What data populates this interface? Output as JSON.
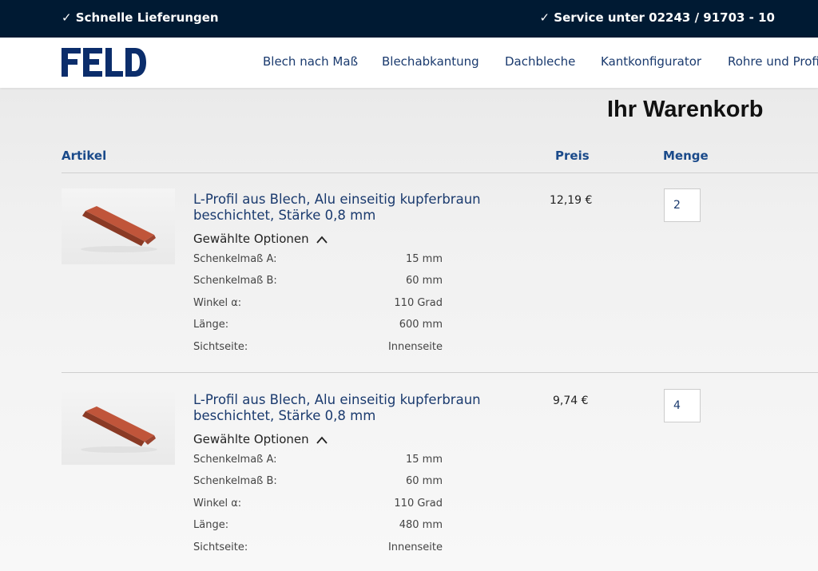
{
  "topbar": {
    "left": "✓ Schnelle Lieferungen",
    "right": "✓ Service unter 02243 / 91703 - 10"
  },
  "brand": {
    "logo_text": "FELD",
    "color": "#0b2d6b"
  },
  "nav": [
    "Blech nach Maß",
    "Blechabkantung",
    "Dachbleche",
    "Kantkonfigurator",
    "Rohre und Profi"
  ],
  "page": {
    "title": "Ihr Warenkorb"
  },
  "columns": {
    "article": "Artikel",
    "price": "Preis",
    "quantity": "Menge"
  },
  "cart": [
    {
      "title": "L-Profil aus Blech, Alu einseitig kupferbraun beschichtet, Stärke 0,8 mm",
      "options_label": "Gewählte Optionen",
      "options": [
        {
          "key": "Schenkelmaß A:",
          "value": "15 mm"
        },
        {
          "key": "Schenkelmaß B:",
          "value": "60 mm"
        },
        {
          "key": "Winkel α:",
          "value": "110 Grad"
        },
        {
          "key": "Länge:",
          "value": "600 mm"
        },
        {
          "key": "Sichtseite:",
          "value": "Innenseite"
        }
      ],
      "price": "12,19 €",
      "quantity": "2"
    },
    {
      "title": "L-Profil aus Blech, Alu einseitig kupferbraun beschichtet, Stärke 0,8 mm",
      "options_label": "Gewählte Optionen",
      "options": [
        {
          "key": "Schenkelmaß A:",
          "value": "15 mm"
        },
        {
          "key": "Schenkelmaß B:",
          "value": "60 mm"
        },
        {
          "key": "Winkel α:",
          "value": "110 Grad"
        },
        {
          "key": "Länge:",
          "value": "480 mm"
        },
        {
          "key": "Sichtseite:",
          "value": "Innenseite"
        }
      ],
      "price": "9,74 €",
      "quantity": "4"
    }
  ]
}
